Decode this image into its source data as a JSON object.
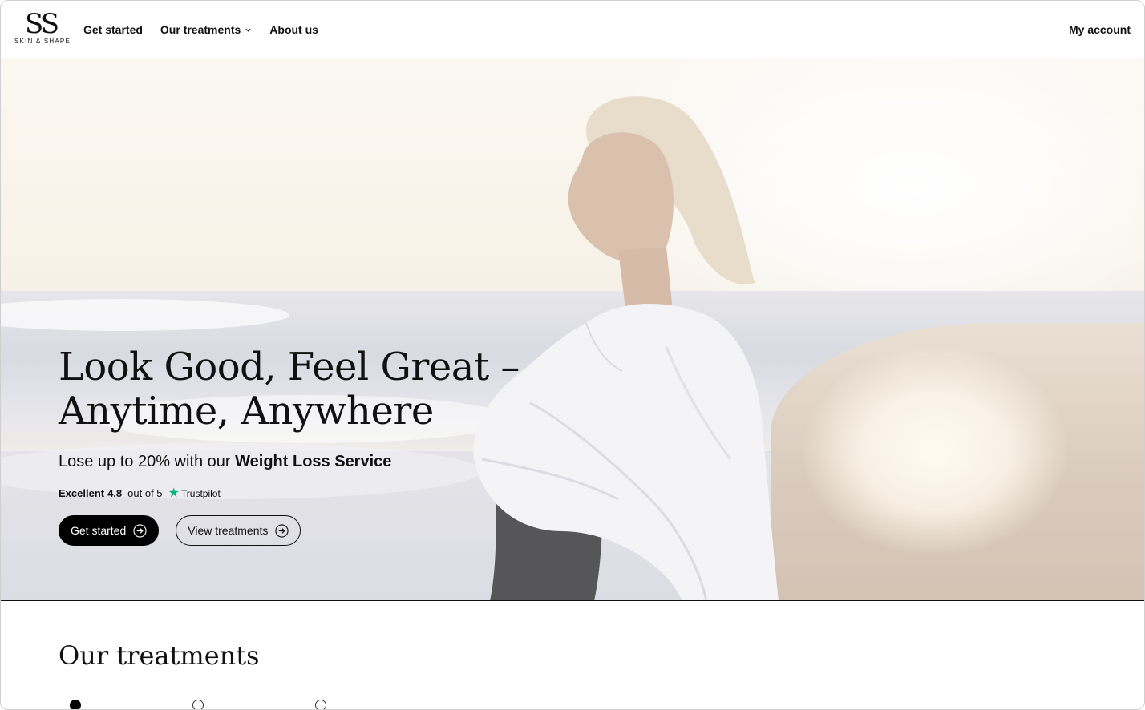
{
  "brand": {
    "mark": "SS",
    "name": "SKIN & SHAPE"
  },
  "nav": {
    "items": [
      {
        "label": "Get started"
      },
      {
        "label": "Our treatments",
        "has_dropdown": true
      },
      {
        "label": "About us"
      }
    ],
    "account_label": "My account"
  },
  "hero": {
    "headline_line1": "Look Good, Feel Great –",
    "headline_line2": "Anytime, Anywhere",
    "subline_prefix": "Lose up to 20% with our ",
    "subline_bold": "Weight Loss Service",
    "rating": {
      "label": "Excellent",
      "score": "4.8",
      "suffix": "out of 5",
      "provider": "Trustpilot",
      "star_color": "#00b67a"
    },
    "primary_cta": "Get started",
    "secondary_cta": "View treatments"
  },
  "treatments": {
    "title": "Our treatments",
    "carousel_dots": 3,
    "active_dot": 0
  },
  "colors": {
    "text": "#111111",
    "primary_button": "#000000",
    "background": "#ffffff"
  }
}
